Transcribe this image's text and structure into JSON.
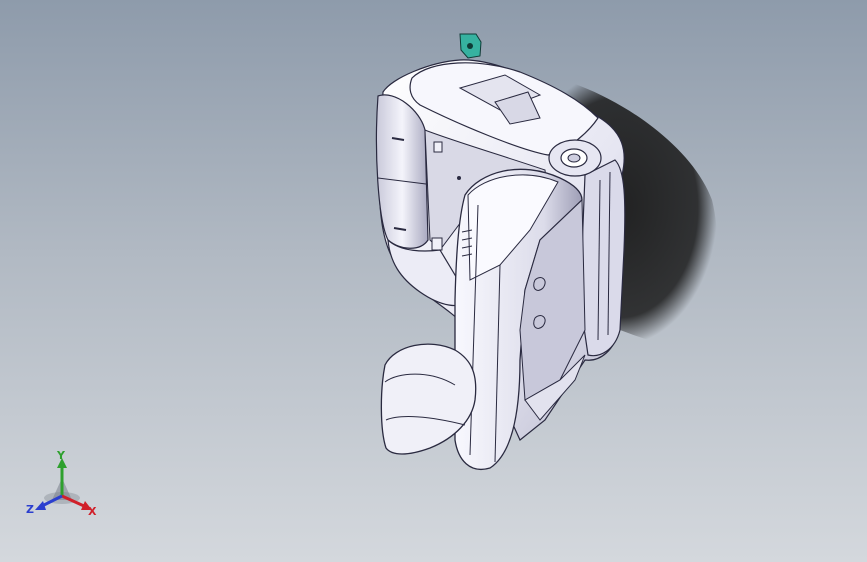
{
  "triad": {
    "x_label": "X",
    "y_label": "Y",
    "z_label": "Z",
    "x_color": "#d0202a",
    "y_color": "#2ea02e",
    "z_color": "#2b3fcf"
  },
  "model": {
    "body_color": "#eeeef8",
    "edge_color": "#2a2a40",
    "fitting_color": "#36b2a0"
  }
}
